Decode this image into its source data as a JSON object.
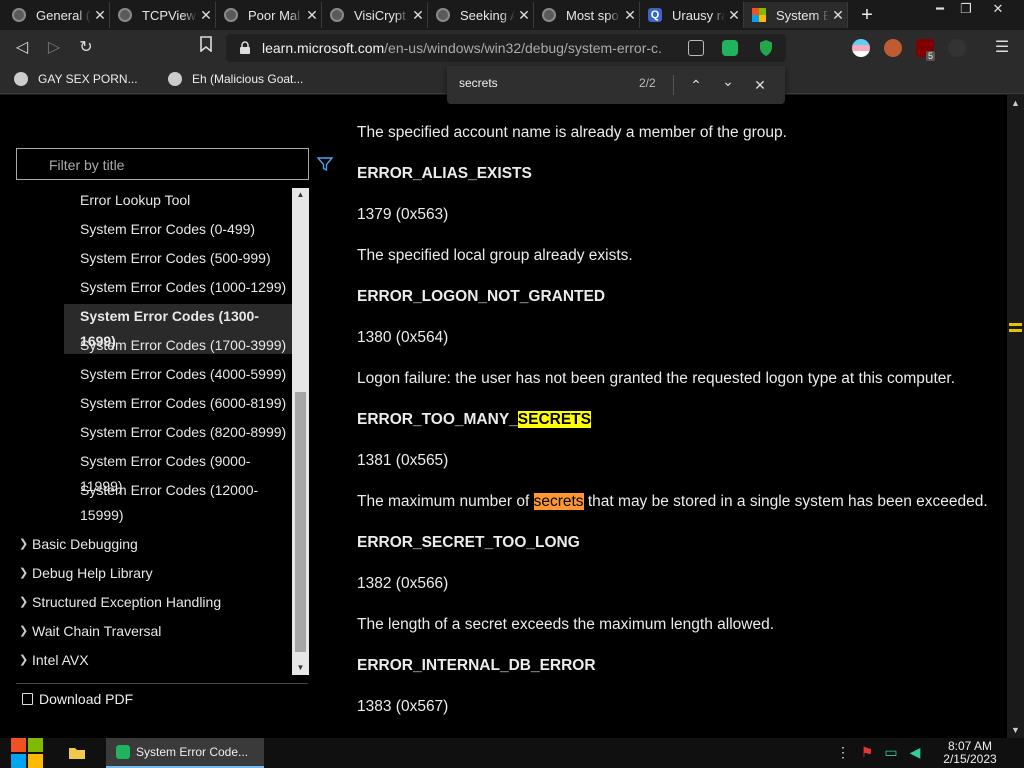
{
  "browser": {
    "tabs": [
      {
        "title": "General (",
        "icon": "globe-icon"
      },
      {
        "title": "TCPView -",
        "icon": "globe-icon"
      },
      {
        "title": "Poor Mal",
        "icon": "globe-icon"
      },
      {
        "title": "VisiCrypt",
        "icon": "globe-icon"
      },
      {
        "title": "Seeking A",
        "icon": "globe-icon"
      },
      {
        "title": "Most spo",
        "icon": "globe-icon"
      },
      {
        "title": "Urausy ra",
        "icon": "q-icon"
      },
      {
        "title": "System E",
        "icon": "microsoft-icon"
      }
    ],
    "active_tab_index": 7,
    "url_host": "learn.microsoft.com",
    "url_path": "/en-us/windows/win32/debug/system-error-c...",
    "bookmarks": [
      "GAY SEX PORN...",
      "Eh (Malicious Goat..."
    ],
    "extension_badge": "5",
    "new_tab_label": "+"
  },
  "find": {
    "query": "secrets",
    "count": "2/2"
  },
  "sidebar": {
    "filter_placeholder": "Filter by title",
    "items": [
      "Error Lookup Tool",
      "System Error Codes (0-499)",
      "System Error Codes (500-999)",
      "System Error Codes (1000-1299)",
      "System Error Codes (1300-1699)",
      "System Error Codes (1700-3999)",
      "System Error Codes (4000-5999)",
      "System Error Codes (6000-8199)",
      "System Error Codes (8200-8999)",
      "System Error Codes (9000-11999)",
      "System Error Codes (12000-",
      "15999)"
    ],
    "selected_index": 4,
    "sections": [
      "Basic Debugging",
      "Debug Help Library",
      "Structured Exception Handling",
      "Wait Chain Traversal",
      "Intel AVX"
    ],
    "download_pdf": "Download PDF"
  },
  "article": {
    "lines": [
      {
        "text": "The specified account name is already a member of the group.",
        "kind": "desc"
      },
      {
        "text": "ERROR_ALIAS_EXISTS",
        "kind": "name"
      },
      {
        "text": "1379 (0x563)",
        "kind": "code"
      },
      {
        "text": "The specified local group already exists.",
        "kind": "desc"
      },
      {
        "text": "ERROR_LOGON_NOT_GRANTED",
        "kind": "name"
      },
      {
        "text": "1380 (0x564)",
        "kind": "code"
      },
      {
        "text": "Logon failure: the user has not been granted the requested logon type at this computer.",
        "kind": "desc"
      },
      {
        "text_before": "ERROR_TOO_MANY_",
        "match": "SECRETS",
        "text_after": "",
        "kind": "name"
      },
      {
        "text": "1381 (0x565)",
        "kind": "code"
      },
      {
        "text_before": "The maximum number of ",
        "match": "secrets",
        "text_after": " that may be stored in a single system has been exceeded.",
        "kind": "desc"
      },
      {
        "text": "ERROR_SECRET_TOO_LONG",
        "kind": "name"
      },
      {
        "text": "1382 (0x566)",
        "kind": "code"
      },
      {
        "text": "The length of a secret exceeds the maximum length allowed.",
        "kind": "desc"
      },
      {
        "text": "ERROR_INTERNAL_DB_ERROR",
        "kind": "name"
      },
      {
        "text": "1383 (0x567)",
        "kind": "code"
      }
    ],
    "highlight_colors": {
      "match": "#ffff00",
      "current_match": "#ff9632"
    }
  },
  "taskbar": {
    "app_label": "System Error Code...",
    "time": "8:07 AM",
    "date": "2/15/2023"
  }
}
